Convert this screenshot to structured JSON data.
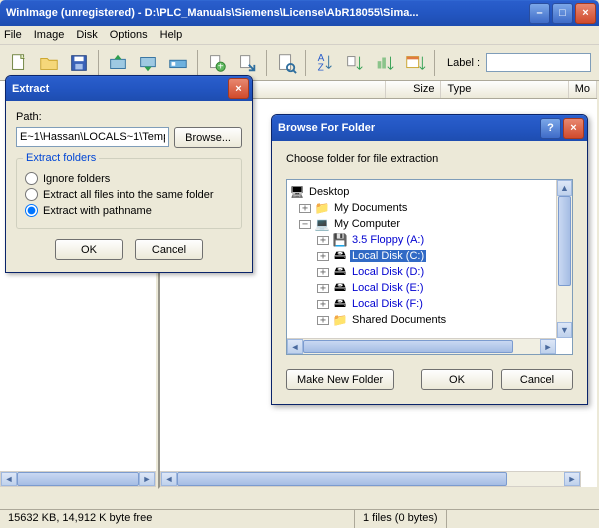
{
  "window": {
    "title": "WinImage (unregistered) - D:\\PLC_Manuals\\Siemens\\License\\AbR18055\\Sima..."
  },
  "menu": {
    "file": "File",
    "image": "Image",
    "disk": "Disk",
    "options": "Options",
    "help": "Help"
  },
  "toolbar": {
    "label_caption": "Label :",
    "label_value": ""
  },
  "columns": {
    "size": "Size",
    "type": "Type",
    "mod": "Mo"
  },
  "status": {
    "left": "15632 KB, 14,912 K byte free",
    "right": "1 files (0 bytes)"
  },
  "extract": {
    "title": "Extract",
    "path_label": "Path:",
    "path_value": "E~1\\Hassan\\LOCALS~1\\Temp\\",
    "browse": "Browse...",
    "group": "Extract folders",
    "opt_ignore": "Ignore folders",
    "opt_same": "Extract all files into the same folder",
    "opt_pathname": "Extract with pathname",
    "ok": "OK",
    "cancel": "Cancel"
  },
  "browse": {
    "title": "Browse For Folder",
    "hint": "Choose folder for file extraction",
    "make": "Make New Folder",
    "ok": "OK",
    "cancel": "Cancel",
    "tree": {
      "desktop": "Desktop",
      "mydocs": "My Documents",
      "mycomp": "My Computer",
      "floppy": "3.5 Floppy (A:)",
      "cdisk": "Local Disk (C:)",
      "ddisk": "Local Disk (D:)",
      "edisk": "Local Disk (E:)",
      "fdisk": "Local Disk (F:)",
      "shared": "Shared Documents"
    }
  }
}
